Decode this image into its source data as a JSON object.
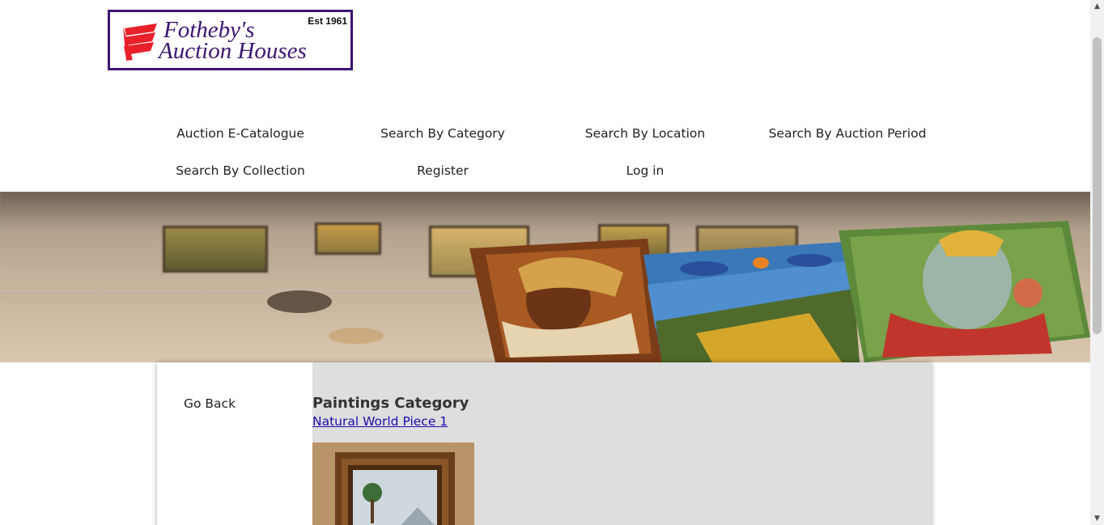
{
  "logo": {
    "name_line1": "Fotheby's",
    "name_line2": "Auction Houses",
    "est": "Est 1961",
    "border_color": "#3d1470",
    "mark_color": "#e8202a"
  },
  "nav": {
    "items": [
      {
        "label": "Auction E-Catalogue"
      },
      {
        "label": "Search By Category"
      },
      {
        "label": "Search By Location"
      },
      {
        "label": "Search By Auction Period"
      },
      {
        "label": "Search By Collection"
      },
      {
        "label": "Register"
      },
      {
        "label": "Log in"
      }
    ]
  },
  "sidebar": {
    "go_back": "Go Back"
  },
  "main": {
    "category_title": "Paintings Category",
    "item_link": "Natural World Piece 1"
  },
  "colors": {
    "main_bg": "#dedede",
    "link": "#1a0dab"
  }
}
